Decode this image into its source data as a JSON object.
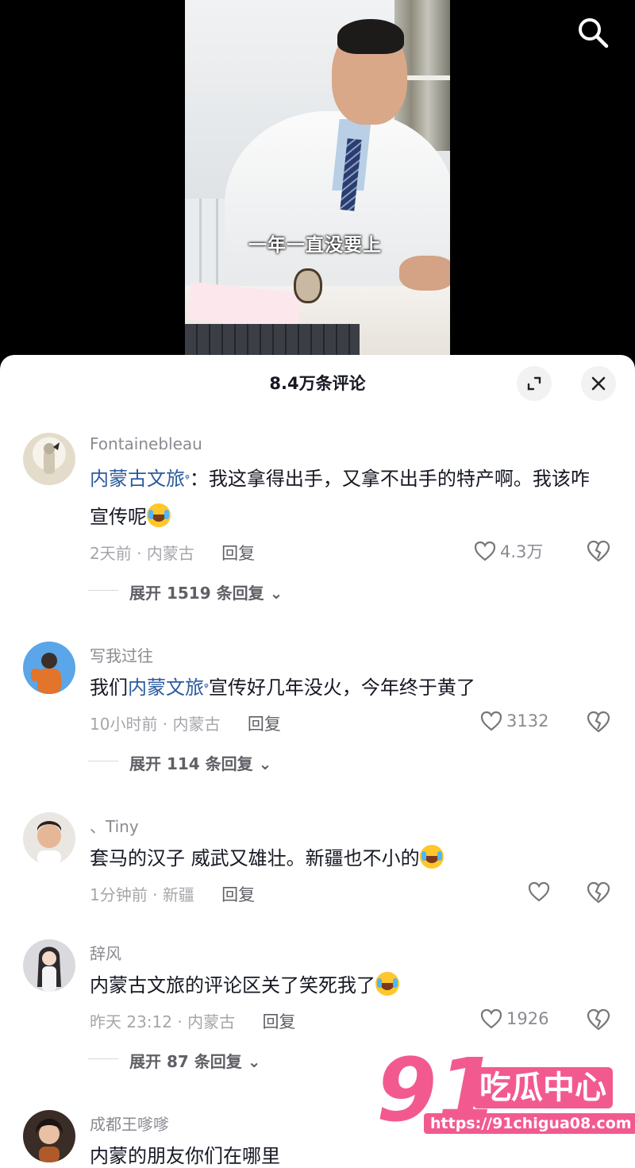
{
  "video": {
    "caption": "一年一直没要上"
  },
  "sheet": {
    "title": "8.4万条评论"
  },
  "comments": [
    {
      "username": "Fontainebleau",
      "mention": "内蒙古文旅",
      "text_after_mention": "：我这拿得出手，又拿不出手的特产啊。我该咋宣传呢",
      "time": "2天前",
      "location": "内蒙古",
      "reply_label": "回复",
      "likes": "4.3万",
      "expand": "展开 1519 条回复"
    },
    {
      "username": "写我过往",
      "text_before_mention": "我们",
      "mention": "内蒙文旅",
      "text_after_mention": "宣传好几年没火，今年终于黄了",
      "time": "10小时前",
      "location": "内蒙古",
      "reply_label": "回复",
      "likes": "3132",
      "expand": "展开 114 条回复"
    },
    {
      "username": "、Tiny",
      "text": "套马的汉子 威武又雄壮。新疆也不小的",
      "time": "1分钟前",
      "location": "新疆",
      "reply_label": "回复",
      "likes": ""
    },
    {
      "username": "辞风",
      "text": "内蒙古文旅的评论区关了笑死我了",
      "time": "昨天 23:12",
      "location": "内蒙古",
      "reply_label": "回复",
      "likes": "1926",
      "expand": "展开 87 条回复"
    },
    {
      "username": "成都王嗲嗲",
      "text": "内蒙的朋友你们在哪里"
    }
  ],
  "watermark": {
    "number": "91",
    "brand": "吃瓜中心",
    "url": "https://91chigua08.com"
  },
  "colors": {
    "mention": "#2b5a9e",
    "watermark": "#f25a8f",
    "text": "#161823",
    "meta": "#a5a6ab"
  }
}
